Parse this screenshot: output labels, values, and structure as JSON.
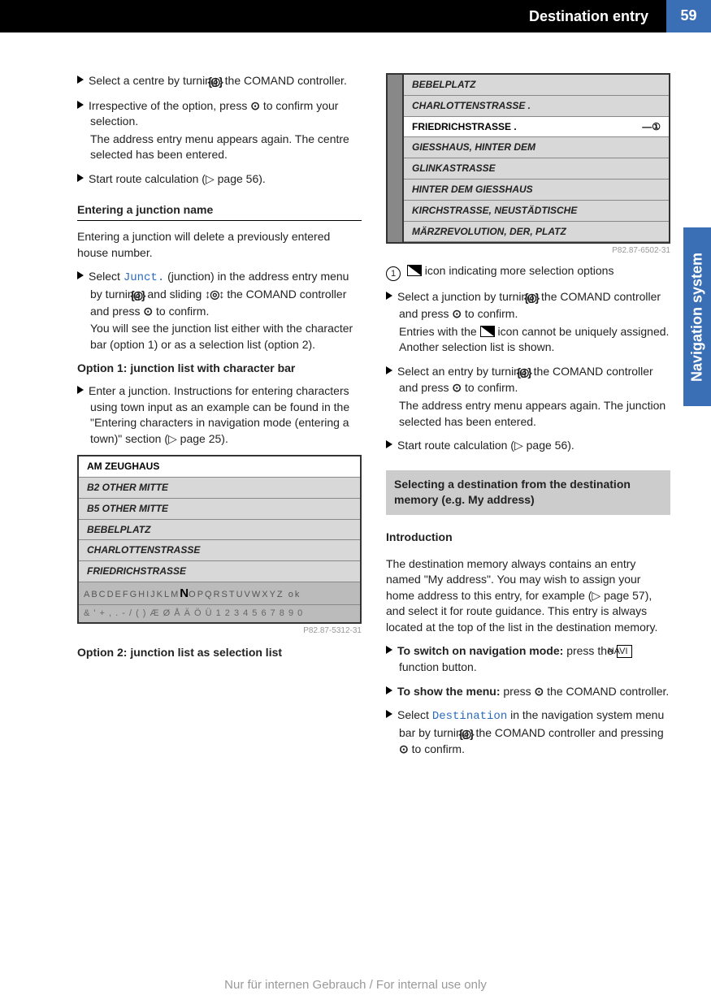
{
  "header": {
    "title": "Destination entry",
    "page": "59"
  },
  "side_tab": "Navigation system",
  "col1": {
    "step1a": "Select a centre by turning",
    "step1b": " the COMAND controller.",
    "step2a": "Irrespective of the option, press ",
    "step2b": " to confirm your selection.",
    "step2c": "The address entry menu appears again. The centre selected has been entered.",
    "step3a": "Start route calculation (",
    "step3b": " page 56).",
    "h_junction": "Entering a junction name",
    "intro": "Entering a junction will delete a previously entered house number.",
    "j1a": "Select ",
    "j1_cmd": "Junct.",
    "j1b": " (junction) in the address entry menu by turning ",
    "j1c": " and sliding ",
    "j1d": " the COMAND controller and press ",
    "j1e": " to confirm.",
    "j1f": "You will see the junction list either with the character bar (option 1) or as a selection list (option 2).",
    "opt1_h": "Option 1: junction list with character bar",
    "opt1a": "Enter a junction. Instructions for entering characters using town input as an example can be found in the \"Entering characters in navigation mode (entering a town)\" section (",
    "opt1b": " page 25).",
    "sc1": {
      "rows": [
        "AM ZEUGHAUS",
        "B2 OTHER MITTE",
        "B5 OTHER MITTE",
        "BEBELPLATZ",
        "CHARLOTTENSTRASSE",
        "FRIEDRICHSTRASSE"
      ],
      "chars_pre": "ABCDEFGHIJKLM",
      "chars_big": "N",
      "chars_post": "OPQRSTUVWXYZ ok",
      "sym": "& ' + , . - / ( ) Æ Ø Å Ä Ö Ü 1 2 3 4 5 6 7 8 9 0",
      "ref": "P82.87-5312-31"
    },
    "opt2_h": "Option 2: junction list as selection list"
  },
  "col2": {
    "sc2": {
      "rows": [
        "BEBELPLATZ",
        "CHARLOTTENSTRASSE .",
        "FRIEDRICHSTRASSE .",
        "GIESSHAUS, HINTER DEM",
        "GLINKASTRASSE",
        "HINTER DEM GIESSHAUS",
        "KIRCHSTRASSE, NEUSTÄDTISCHE",
        "MÄRZREVOLUTION, DER, PLATZ"
      ],
      "ref": "P82.87-6502-31"
    },
    "callout1": " icon indicating more selection options",
    "r1a": "Select a junction by turning ",
    "r1b": " the COMAND controller and press ",
    "r1c": " to confirm.",
    "r1d": "Entries with the ",
    "r1e": " icon cannot be uniquely assigned. Another selection list is shown.",
    "r2a": "Select an entry by turning ",
    "r2b": " the COMAND controller and press ",
    "r2c": " to confirm.",
    "r2d": "The address entry menu appears again. The junction selected has been entered.",
    "r3a": "Start route calculation (",
    "r3b": " page 56).",
    "secbox": "Selecting a destination from the destination memory (e.g. My address)",
    "h_intro": "Introduction",
    "intro_p": "The destination memory always contains an entry named \"My address\". You may wish to assign your home address to this entry, for example (",
    "intro_pb": " page 57), and select it for route guidance. This entry is always located at the top of the list in the destination memory.",
    "n1a": "To switch on navigation mode:",
    "n1b": " press the ",
    "n1c": " function button.",
    "navi": "NAVI",
    "n2a": "To show the menu:",
    "n2b": " press ",
    "n2c": " the COMAND controller.",
    "n3a": "Select ",
    "n3_cmd": "Destination",
    "n3b": " in the navigation system menu bar by turning ",
    "n3c": " the COMAND controller and pressing ",
    "n3d": " to confirm."
  },
  "footer": "Nur für internen Gebrauch / For internal use only"
}
